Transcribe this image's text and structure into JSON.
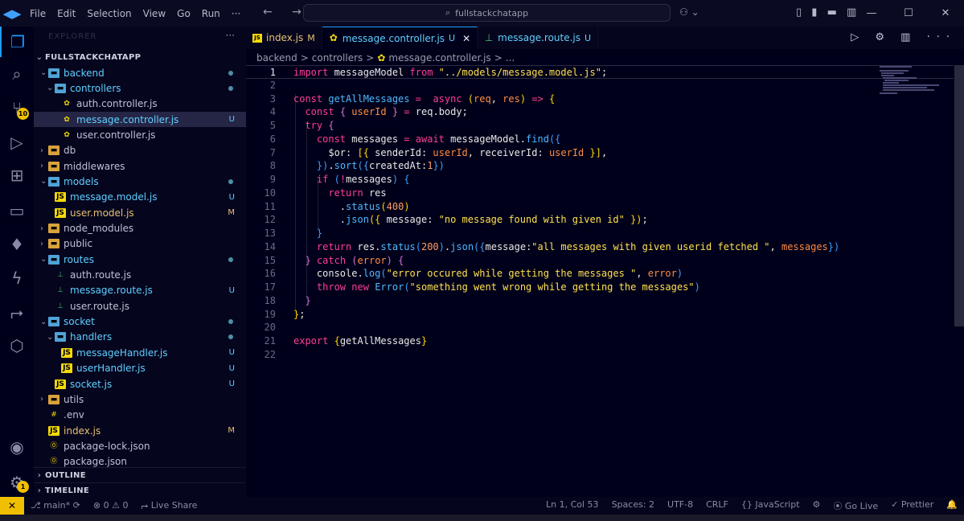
{
  "titlebar": {
    "logo": "◀▶",
    "menu": [
      "File",
      "Edit",
      "Selection",
      "View",
      "Go",
      "Run",
      "···"
    ],
    "nav_arrows": "← →",
    "search_text": "fullstackchatapp",
    "search_icon": "search-icon",
    "copilot_icon": "copilot-icon",
    "layout_icons": "▯ ▮ ▬ ▥",
    "window_controls": [
      "—",
      "☐",
      "✕"
    ]
  },
  "activity": {
    "icons": [
      "files-icon",
      "search-icon",
      "source-control-icon",
      "run-debug-icon",
      "extensions-icon",
      "remote-explorer-icon",
      "mongodb-icon",
      "thunder-client-icon",
      "live-share-icon",
      "packages-icon",
      "account-icon",
      "settings-icon"
    ],
    "source_control_badge": "10",
    "settings_badge": "1"
  },
  "sidebar": {
    "header": "EXPLORER",
    "more": "···",
    "root": "FULLSTACKCHATAPP",
    "tree": [
      {
        "label": "backend",
        "type": "folder",
        "depth": 1,
        "open": true,
        "status": "dot",
        "color": "#5fd0ff"
      },
      {
        "label": "controllers",
        "type": "folder",
        "depth": 2,
        "open": true,
        "status": "dot",
        "color": "#5fd0ff"
      },
      {
        "label": "auth.controller.js",
        "type": "gear",
        "depth": 3,
        "status": "",
        "color": "#c0c0d8"
      },
      {
        "label": "message.controller.js",
        "type": "gear",
        "depth": 3,
        "status": "U",
        "color": "#5fd0ff",
        "selected": true
      },
      {
        "label": "user.controller.js",
        "type": "gear",
        "depth": 3,
        "status": "",
        "color": "#c0c0d8"
      },
      {
        "label": "db",
        "type": "folder",
        "depth": 1,
        "open": false,
        "status": "",
        "color": "#c0c0d8"
      },
      {
        "label": "middlewares",
        "type": "folder",
        "depth": 1,
        "open": false,
        "status": "",
        "color": "#c0c0d8"
      },
      {
        "label": "models",
        "type": "folder",
        "depth": 1,
        "open": true,
        "status": "dot",
        "color": "#5fd0ff"
      },
      {
        "label": "message.model.js",
        "type": "js",
        "depth": 2,
        "status": "U",
        "color": "#5fd0ff"
      },
      {
        "label": "user.model.js",
        "type": "js",
        "depth": 2,
        "status": "M",
        "color": "#e8c070"
      },
      {
        "label": "node_modules",
        "type": "folder",
        "depth": 1,
        "open": false,
        "status": "",
        "color": "#c0c0d8"
      },
      {
        "label": "public",
        "type": "folder",
        "depth": 1,
        "open": false,
        "status": "",
        "color": "#c0c0d8"
      },
      {
        "label": "routes",
        "type": "folder",
        "depth": 1,
        "open": true,
        "status": "dot",
        "color": "#5fd0ff"
      },
      {
        "label": "auth.route.js",
        "type": "route",
        "depth": 2,
        "status": "",
        "color": "#c0c0d8"
      },
      {
        "label": "message.route.js",
        "type": "route",
        "depth": 2,
        "status": "U",
        "color": "#5fd0ff"
      },
      {
        "label": "user.route.js",
        "type": "route",
        "depth": 2,
        "status": "",
        "color": "#c0c0d8"
      },
      {
        "label": "socket",
        "type": "folder",
        "depth": 1,
        "open": true,
        "status": "dot",
        "color": "#5fd0ff"
      },
      {
        "label": "handlers",
        "type": "folder",
        "depth": 2,
        "open": true,
        "status": "dot",
        "color": "#5fd0ff"
      },
      {
        "label": "messageHandler.js",
        "type": "js",
        "depth": 3,
        "status": "U",
        "color": "#5fd0ff"
      },
      {
        "label": "userHandler.js",
        "type": "js",
        "depth": 3,
        "status": "U",
        "color": "#5fd0ff"
      },
      {
        "label": "socket.js",
        "type": "js",
        "depth": 2,
        "status": "U",
        "color": "#5fd0ff"
      },
      {
        "label": "utils",
        "type": "folder",
        "depth": 1,
        "open": false,
        "status": "",
        "color": "#c0c0d8"
      },
      {
        "label": ".env",
        "type": "env",
        "depth": 1,
        "status": "",
        "color": "#c0c0d8"
      },
      {
        "label": "index.js",
        "type": "js",
        "depth": 1,
        "status": "M",
        "color": "#e8c070"
      },
      {
        "label": "package-lock.json",
        "type": "npm",
        "depth": 1,
        "status": "",
        "color": "#c0c0d8"
      },
      {
        "label": "package.json",
        "type": "npm",
        "depth": 1,
        "status": "",
        "color": "#c0c0d8"
      }
    ],
    "outline": "OUTLINE",
    "timeline": "TIMELINE"
  },
  "tabs": [
    {
      "label": "index.js",
      "status": "M",
      "icon": "js",
      "status_color": "#e8c070",
      "label_color": "#e8c070"
    },
    {
      "label": "message.controller.js",
      "status": "U",
      "icon": "gear",
      "status_color": "#5fd0ff",
      "label_color": "#5fd0ff",
      "active": true,
      "close": "✕"
    },
    {
      "label": "message.route.js",
      "status": "U",
      "icon": "route",
      "status_color": "#5fd0ff",
      "label_color": "#5fd0ff"
    }
  ],
  "tab_actions": "▷ ⚙ ▥ ···",
  "breadcrumb": [
    "backend",
    ">",
    "controllers",
    ">",
    "message.controller.js",
    ">",
    "..."
  ],
  "editor": {
    "lines": [
      {
        "n": "1",
        "cur": true,
        "t": [
          [
            "k",
            "import"
          ],
          [
            "p",
            " messageModel "
          ],
          [
            "k",
            "from"
          ],
          [
            "p",
            " "
          ],
          [
            "s",
            "\"../models/message.model.js\""
          ],
          [
            "p",
            ";"
          ]
        ]
      },
      {
        "n": "2",
        "t": []
      },
      {
        "n": "3",
        "t": [
          [
            "k",
            "const"
          ],
          [
            "p",
            " "
          ],
          [
            "f",
            "getAllMessages"
          ],
          [
            "p",
            " "
          ],
          [
            "o",
            "="
          ],
          [
            "p",
            "  "
          ],
          [
            "k",
            "async"
          ],
          [
            "p",
            " "
          ],
          [
            "b1",
            "("
          ],
          [
            "pa",
            "req"
          ],
          [
            "p",
            ", "
          ],
          [
            "pa",
            "res"
          ],
          [
            "b1",
            ")"
          ],
          [
            "p",
            " "
          ],
          [
            "o",
            "=>"
          ],
          [
            "p",
            " "
          ],
          [
            "b1",
            "{"
          ]
        ]
      },
      {
        "n": "4",
        "t": [
          [
            "p",
            "  "
          ],
          [
            "k",
            "const"
          ],
          [
            "p",
            " "
          ],
          [
            "b2",
            "{"
          ],
          [
            "p",
            " "
          ],
          [
            "pr",
            "userId"
          ],
          [
            "p",
            " "
          ],
          [
            "b2",
            "}"
          ],
          [
            "p",
            " "
          ],
          [
            "o",
            "="
          ],
          [
            "p",
            " req.body;"
          ]
        ]
      },
      {
        "n": "5",
        "t": [
          [
            "p",
            "  "
          ],
          [
            "k",
            "try"
          ],
          [
            "p",
            " "
          ],
          [
            "b2",
            "{"
          ]
        ]
      },
      {
        "n": "6",
        "t": [
          [
            "p",
            "    "
          ],
          [
            "k",
            "const"
          ],
          [
            "p",
            " messages "
          ],
          [
            "o",
            "="
          ],
          [
            "p",
            " "
          ],
          [
            "k",
            "await"
          ],
          [
            "p",
            " messageModel."
          ],
          [
            "f",
            "find"
          ],
          [
            "b3",
            "({"
          ]
        ]
      },
      {
        "n": "7",
        "t": [
          [
            "p",
            "      $or: "
          ],
          [
            "b1",
            "[{"
          ],
          [
            "p",
            " senderId: "
          ],
          [
            "pr",
            "userId"
          ],
          [
            "p",
            ", receiverId: "
          ],
          [
            "pr",
            "userId"
          ],
          [
            "p",
            " "
          ],
          [
            "b1",
            "}]"
          ],
          [
            "p",
            ","
          ]
        ]
      },
      {
        "n": "8",
        "t": [
          [
            "p",
            "    "
          ],
          [
            "b3",
            "})"
          ],
          [
            "p",
            "."
          ],
          [
            "f",
            "sort"
          ],
          [
            "b3",
            "({"
          ],
          [
            "p",
            "createdAt:"
          ],
          [
            "n",
            "1"
          ],
          [
            "b3",
            "})"
          ]
        ]
      },
      {
        "n": "9",
        "t": [
          [
            "p",
            "    "
          ],
          [
            "k",
            "if"
          ],
          [
            "p",
            " "
          ],
          [
            "b3",
            "("
          ],
          [
            "o",
            "!"
          ],
          [
            "p",
            "messages"
          ],
          [
            "b3",
            ")"
          ],
          [
            "p",
            " "
          ],
          [
            "b3",
            "{"
          ]
        ]
      },
      {
        "n": "10",
        "t": [
          [
            "p",
            "      "
          ],
          [
            "k",
            "return"
          ],
          [
            "p",
            " res"
          ]
        ]
      },
      {
        "n": "11",
        "t": [
          [
            "p",
            "        ."
          ],
          [
            "f",
            "status"
          ],
          [
            "b1",
            "("
          ],
          [
            "n",
            "400"
          ],
          [
            "b1",
            ")"
          ]
        ]
      },
      {
        "n": "12",
        "t": [
          [
            "p",
            "        ."
          ],
          [
            "f",
            "json"
          ],
          [
            "b1",
            "({"
          ],
          [
            "p",
            " message: "
          ],
          [
            "s",
            "\"no message found with given id\""
          ],
          [
            "p",
            " "
          ],
          [
            "b1",
            "})"
          ],
          [
            "p",
            ";"
          ]
        ]
      },
      {
        "n": "13",
        "t": [
          [
            "p",
            "    "
          ],
          [
            "b3",
            "}"
          ]
        ]
      },
      {
        "n": "14",
        "t": [
          [
            "p",
            "    "
          ],
          [
            "k",
            "return"
          ],
          [
            "p",
            " res."
          ],
          [
            "f",
            "status"
          ],
          [
            "b3",
            "("
          ],
          [
            "n",
            "200"
          ],
          [
            "b3",
            ")"
          ],
          [
            "p",
            "."
          ],
          [
            "f",
            "json"
          ],
          [
            "b3",
            "({"
          ],
          [
            "p",
            "message:"
          ],
          [
            "s",
            "\"all messages with given userid fetched \""
          ],
          [
            "p",
            ", "
          ],
          [
            "pr",
            "messages"
          ],
          [
            "b3",
            "})"
          ]
        ]
      },
      {
        "n": "15",
        "t": [
          [
            "p",
            "  "
          ],
          [
            "b2",
            "}"
          ],
          [
            "p",
            " "
          ],
          [
            "k",
            "catch"
          ],
          [
            "p",
            " "
          ],
          [
            "b2",
            "("
          ],
          [
            "pa",
            "error"
          ],
          [
            "b2",
            ")"
          ],
          [
            "p",
            " "
          ],
          [
            "b2",
            "{"
          ]
        ]
      },
      {
        "n": "16",
        "t": [
          [
            "p",
            "    console."
          ],
          [
            "f",
            "log"
          ],
          [
            "b3",
            "("
          ],
          [
            "s",
            "\"error occured while getting the messages \""
          ],
          [
            "p",
            ", "
          ],
          [
            "pa",
            "error"
          ],
          [
            "b3",
            ")"
          ]
        ]
      },
      {
        "n": "17",
        "t": [
          [
            "p",
            "    "
          ],
          [
            "k",
            "throw"
          ],
          [
            "p",
            " "
          ],
          [
            "k",
            "new"
          ],
          [
            "p",
            " "
          ],
          [
            "c",
            "Error"
          ],
          [
            "b3",
            "("
          ],
          [
            "s",
            "\"something went wrong while getting the messages\""
          ],
          [
            "b3",
            ")"
          ]
        ]
      },
      {
        "n": "18",
        "t": [
          [
            "p",
            "  "
          ],
          [
            "b2",
            "}"
          ]
        ]
      },
      {
        "n": "19",
        "t": [
          [
            "b1",
            "}"
          ],
          [
            "p",
            ";"
          ]
        ]
      },
      {
        "n": "20",
        "t": []
      },
      {
        "n": "21",
        "t": [
          [
            "k",
            "export"
          ],
          [
            "p",
            " "
          ],
          [
            "b1",
            "{"
          ],
          [
            "p",
            "getAllMessages"
          ],
          [
            "b1",
            "}"
          ]
        ]
      },
      {
        "n": "22",
        "t": []
      }
    ]
  },
  "status": {
    "remote": "✕",
    "left": [
      {
        "name": "branch",
        "text": "⎇ main* ⟳"
      },
      {
        "name": "problems",
        "text": "⊗ 0 ⚠ 0"
      },
      {
        "name": "live-share",
        "text": "⮣ Live Share"
      }
    ],
    "right": [
      {
        "name": "cursor-position",
        "text": "Ln 1, Col 53"
      },
      {
        "name": "indentation",
        "text": "Spaces: 2"
      },
      {
        "name": "encoding",
        "text": "UTF-8"
      },
      {
        "name": "eol",
        "text": "CRLF"
      },
      {
        "name": "language",
        "text": "{} JavaScript"
      },
      {
        "name": "copilot",
        "text": "⚙"
      },
      {
        "name": "go-live",
        "text": "⦿ Go Live"
      },
      {
        "name": "prettier",
        "text": "✓ Prettier"
      },
      {
        "name": "notifications",
        "text": "🔔"
      }
    ]
  },
  "colors": {
    "accent": "#1e9bff",
    "untracked": "#5fd0ff",
    "modified": "#e8c070",
    "badge": "#f0c000"
  }
}
